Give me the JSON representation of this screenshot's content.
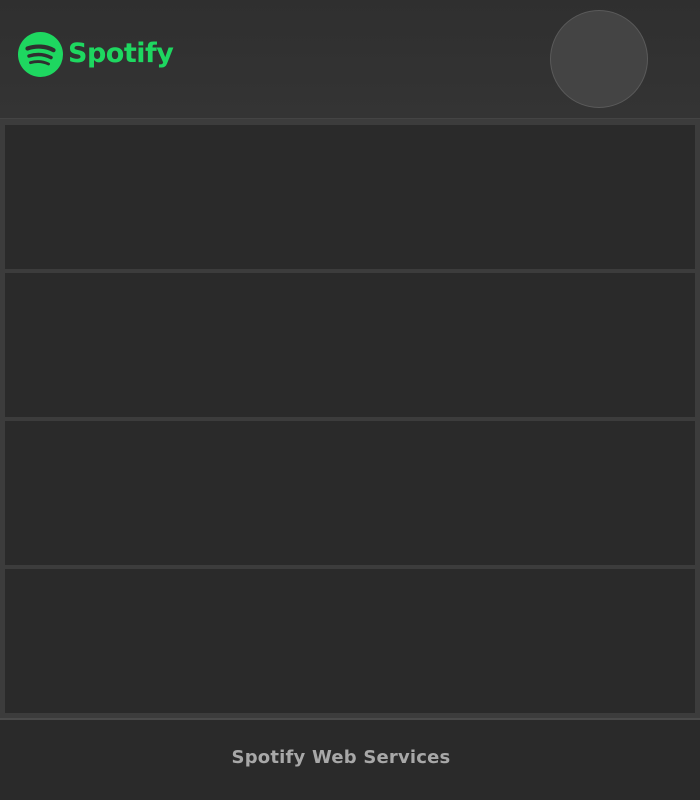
{
  "header": {
    "brand_name": "Spotify",
    "logo_icon": "spotify-logo-icon",
    "avatar_icon": "user-avatar"
  },
  "cards": [
    {
      "label": ""
    },
    {
      "label": ""
    },
    {
      "label": ""
    },
    {
      "label": ""
    }
  ],
  "footer": {
    "text": "Spotify Web Services"
  },
  "colors": {
    "brand_green": "#1ED760",
    "background": "#2a2a2a",
    "header_bg": "#333333",
    "footer_text": "#a8a8a8"
  }
}
